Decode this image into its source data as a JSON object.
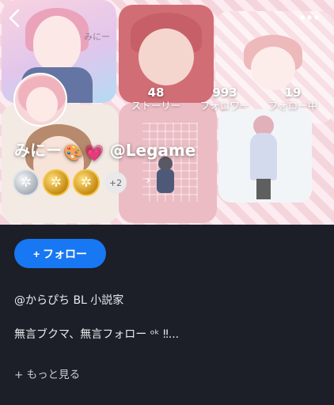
{
  "profile": {
    "display_name": "みにー",
    "name_emoji_1": "🎨",
    "name_emoji_2": "💗",
    "handle": "@Legame"
  },
  "header": {
    "back_icon": "chevron-left-icon",
    "more_icon": "more-horizontal-icon"
  },
  "stats": [
    {
      "value": "48",
      "label": "ストーリー"
    },
    {
      "value": "993",
      "label": "フォロワー"
    },
    {
      "value": "19",
      "label": "フォロー中"
    }
  ],
  "hero": {
    "tile_signature": "みにー"
  },
  "badges": {
    "items": [
      {
        "kind": "silver",
        "icon": "badge-silver-icon"
      },
      {
        "kind": "gold",
        "icon": "badge-gold-icon"
      },
      {
        "kind": "gold",
        "icon": "badge-gold-icon"
      }
    ],
    "more_count": "+2"
  },
  "actions": {
    "follow_label": "+ フォロー"
  },
  "bio": {
    "line1": "@からぴち BL 小説家",
    "line2": "無言ブクマ、無言フォロー ᵒᵏ ‼...",
    "see_more": "+ もっと見る"
  },
  "colors": {
    "accent": "#1877f2",
    "background": "#1c1f27"
  }
}
